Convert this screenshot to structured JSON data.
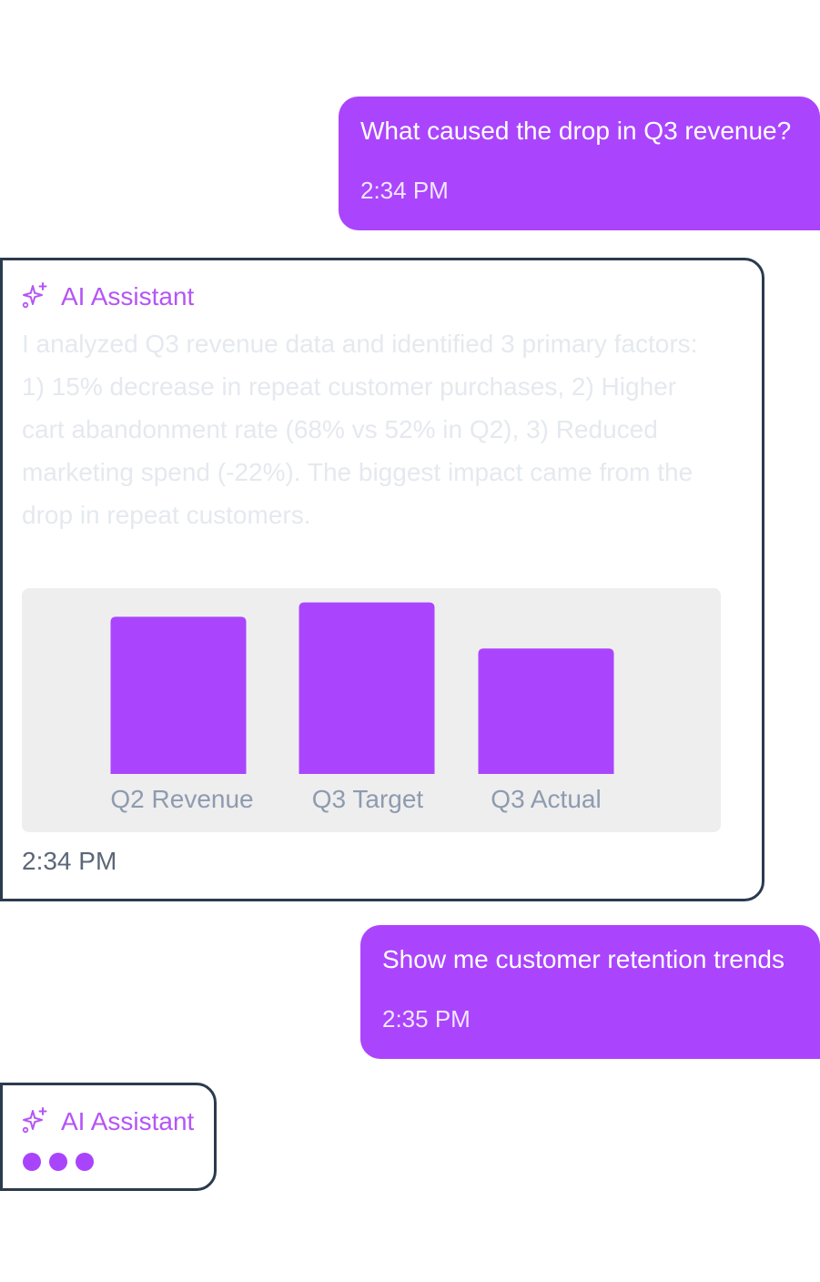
{
  "messages": [
    {
      "role": "user",
      "text": "What caused the drop in Q3 revenue?",
      "time": "2:34 PM"
    },
    {
      "role": "assistant",
      "sender": "AI Assistant",
      "icon": "sparkle-icon",
      "text": "I analyzed Q3 revenue data and identified 3 primary factors:\n1) 15% decrease in repeat customer purchases, 2) Higher\ncart abandonment rate (68% vs 52% in Q2), 3) Reduced\nmarketing spend (-22%). The biggest impact came from the\ndrop in repeat customers.",
      "time": "2:34 PM"
    },
    {
      "role": "user",
      "text": "Show me customer retention trends",
      "time": "2:35 PM"
    },
    {
      "role": "assistant",
      "sender": "AI Assistant",
      "icon": "sparkle-icon",
      "typing": true
    }
  ],
  "colors": {
    "accent": "#aa45fd",
    "assistant_name": "#b555f5",
    "card_border": "#2b3a4e",
    "chart_bg": "#eeeeee",
    "tick_label": "#8e9bb0"
  },
  "chart_data": {
    "type": "bar",
    "categories": [
      "Q2 Revenue",
      "Q3 Target",
      "Q3 Actual"
    ],
    "values": [
      1.09,
      1.19,
      0.87
    ],
    "ylim": [
      0,
      1.2
    ],
    "title": "",
    "xlabel": "",
    "ylabel": "",
    "grid": false
  }
}
